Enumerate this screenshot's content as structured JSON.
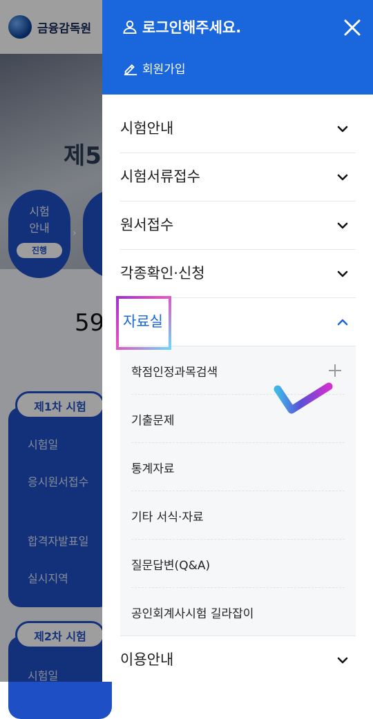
{
  "background": {
    "logo_text": "금융감독원",
    "hero_title": "제5",
    "steps": [
      {
        "label_line1": "시험",
        "label_line2": "안내",
        "badge": "진행"
      }
    ],
    "date_text": "59",
    "card1": {
      "pill": "제1차 시험",
      "rows": [
        "시험일",
        "응시원서접수",
        "합격자발표일",
        "실시지역"
      ]
    },
    "card2": {
      "pill": "제2차 시험",
      "rows": [
        "시험일"
      ]
    }
  },
  "drawer": {
    "login_text": "로그인해주세요.",
    "signup_text": "회원가입",
    "menu": [
      {
        "label": "시험안내"
      },
      {
        "label": "시험서류접수"
      },
      {
        "label": "원서접수"
      },
      {
        "label": "각종확인·신청"
      },
      {
        "label": "자료실"
      }
    ],
    "submenu": [
      {
        "label": "학점인정과목검색"
      },
      {
        "label": "기출문제"
      },
      {
        "label": "통계자료"
      },
      {
        "label": "기타 서식·자료"
      },
      {
        "label": "질문답변(Q&A)"
      },
      {
        "label": "공인회계사시험 길라잡이"
      }
    ],
    "last_menu": {
      "label": "이용안내"
    }
  },
  "colors": {
    "drawer_header": "#1a66dc",
    "active_text": "#1a66dc",
    "highlight_gradient": [
      "#a12fd0",
      "#e64fc0",
      "#71d4f5"
    ]
  }
}
